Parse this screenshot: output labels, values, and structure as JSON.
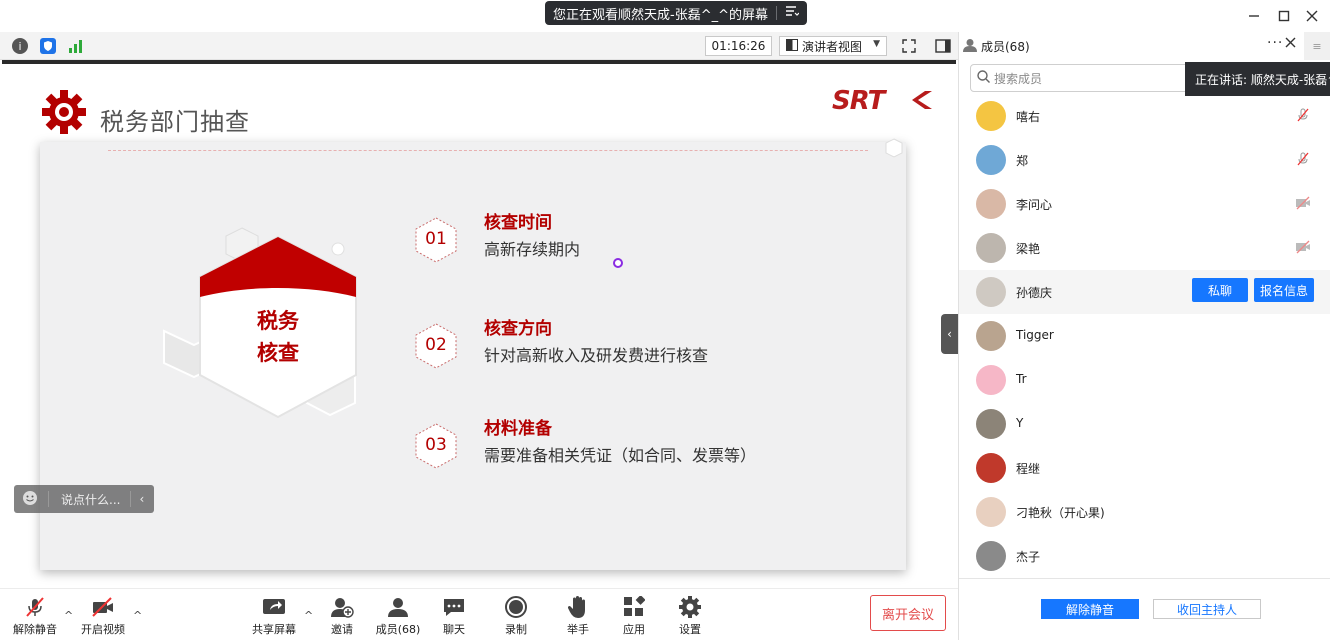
{
  "title_bar": {
    "sharing_label": "您正在观看顺然天成-张磊^_^的屏幕",
    "window_controls": [
      "minimize-icon",
      "maximize-icon",
      "close-icon"
    ]
  },
  "meeting_toolbar": {
    "timer": "01:16:26",
    "view_mode": "演讲者视图"
  },
  "slide": {
    "title": "税务部门抽查",
    "logo": "SRT",
    "badge_line1": "税务",
    "badge_line2": "核查",
    "items": [
      {
        "number": "01",
        "heading": "核查时间",
        "desc": "高新存续期内"
      },
      {
        "number": "02",
        "heading": "核查方向",
        "desc": "针对高新收入及研发费进行核查"
      },
      {
        "number": "03",
        "heading": "材料准备",
        "desc": "需要准备相关凭证（如合同、发票等）"
      }
    ]
  },
  "chat_input": {
    "placeholder": "说点什么..."
  },
  "bottom_bar": {
    "unmute": "解除静音",
    "video": "开启视频",
    "share": "共享屏幕",
    "invite": "邀请",
    "members": "成员(68)",
    "chat": "聊天",
    "record": "录制",
    "raise_hand": "举手",
    "apps": "应用",
    "settings": "设置",
    "leave": "离开会议"
  },
  "member_panel": {
    "title": "成员(68)",
    "search_placeholder": "搜索成员",
    "speaking": "正在讲话: 顺然天成-张磊^_^",
    "private_chat": "私聊",
    "signup_info": "报名信息",
    "members": [
      {
        "name": "嘻右",
        "status": "mic-muted-icon",
        "color": "#f4c542"
      },
      {
        "name": "郑",
        "status": "mic-muted-icon",
        "color": "#6fa8d6"
      },
      {
        "name": "李问心",
        "status": "video-off-icon",
        "color": "#d9b8a6"
      },
      {
        "name": "梁艳",
        "status": "video-off-icon",
        "color": "#bdb6ae"
      },
      {
        "name": "孙德庆",
        "status": "",
        "color": "#cfc9c2"
      },
      {
        "name": "Tigger",
        "status": "",
        "color": "#b9a48f"
      },
      {
        "name": "Tr",
        "status": "",
        "color": "#f6b7c7"
      },
      {
        "name": "Y",
        "status": "",
        "color": "#8c8478"
      },
      {
        "name": "程继",
        "status": "",
        "color": "#c0392b"
      },
      {
        "name": "刁艳秋（开心果)",
        "status": "",
        "color": "#e8d0c0"
      },
      {
        "name": "杰子",
        "status": "",
        "color": "#8a8a8a"
      }
    ],
    "unmute_all": "解除静音",
    "reclaim_host": "收回主持人"
  }
}
